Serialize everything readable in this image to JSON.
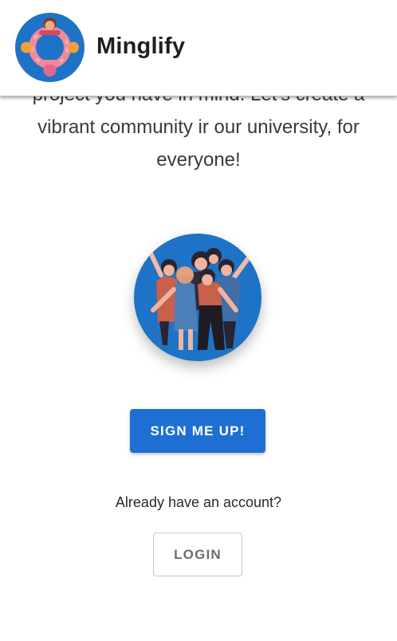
{
  "header": {
    "app_title": "Minglify",
    "logo_icon": "people-circle-logo-icon"
  },
  "intro": {
    "line_1": "project you have in mind. Let's create a",
    "line_2": "vibrant community ir our university, for",
    "line_3": "everyone!"
  },
  "hero": {
    "image_icon": "group-of-friends-illustration"
  },
  "signup": {
    "label": "SIGN ME UP!"
  },
  "login": {
    "prompt": "Already have an account?",
    "label": "LOGIN"
  },
  "colors": {
    "primary": "#1e6fd3",
    "logo_bg": "#1e73c6",
    "text": "#3a3a3a"
  }
}
